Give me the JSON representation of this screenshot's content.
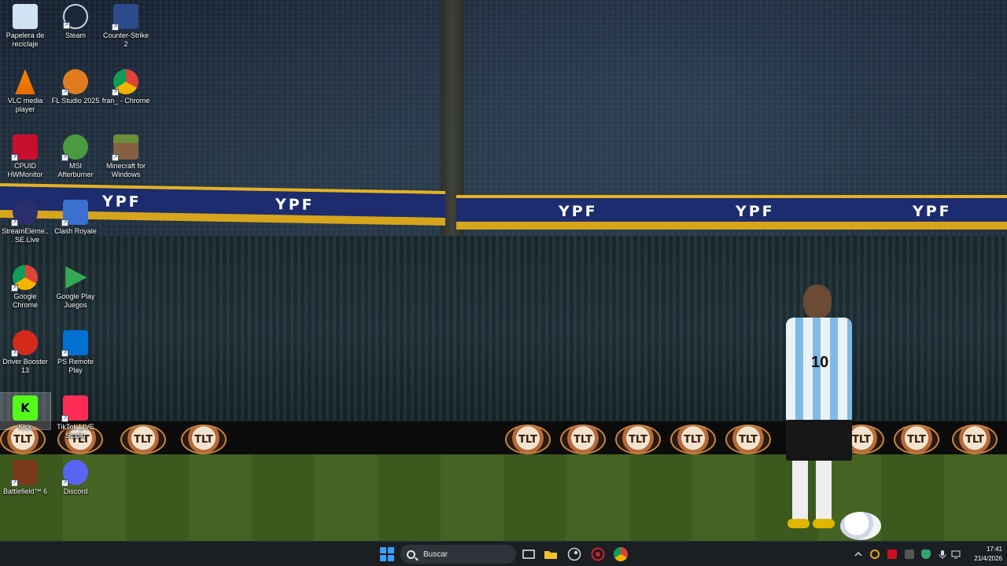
{
  "desktop": {
    "icons": [
      {
        "label": "Papelera de reciclaje",
        "icon": "recycle-bin-icon",
        "color": "#cfe3f5"
      },
      {
        "label": "Steam",
        "icon": "steam-icon",
        "color": "#1b2838"
      },
      {
        "label": "Counter-Strike 2",
        "icon": "counter-strike-icon",
        "color": "#2d4a8a"
      },
      {
        "label": "VLC media player",
        "icon": "vlc-icon",
        "color": "#f08a00"
      },
      {
        "label": "FL Studio 2025",
        "icon": "fl-studio-icon",
        "color": "#e07c1f"
      },
      {
        "label": "fran_ - Chrome",
        "icon": "chrome-profile-icon",
        "color": "#4285f4"
      },
      {
        "label": "CPUID HWMonitor",
        "icon": "hwmonitor-icon",
        "color": "#c8102e"
      },
      {
        "label": "MSI Afterburner",
        "icon": "msi-afterburner-icon",
        "color": "#4a9b3f"
      },
      {
        "label": "Minecraft for Windows",
        "icon": "minecraft-icon",
        "color": "#6b8e3a"
      },
      {
        "label": "StreamEleme... SE.Live",
        "icon": "streamelements-icon",
        "color": "#2a2e6b"
      },
      {
        "label": "Clash Royale",
        "icon": "clash-royale-icon",
        "color": "#3b6fd0"
      },
      {
        "label": "Google Chrome",
        "icon": "chrome-icon",
        "color": "#db4437"
      },
      {
        "label": "Google Play Juegos",
        "icon": "google-play-games-icon",
        "color": "#34a853"
      },
      {
        "label": "Driver Booster 13",
        "icon": "driver-booster-icon",
        "color": "#d42a1c"
      },
      {
        "label": "PS Remote Play",
        "icon": "ps-remote-play-icon",
        "color": "#0070d1"
      },
      {
        "label": "Kick",
        "icon": "kick-icon",
        "color": "#53fc18"
      },
      {
        "label": "TikTok LIVE Studio",
        "icon": "tiktok-live-studio-icon",
        "color": "#fe2c55"
      },
      {
        "label": "Battlefield™ 6",
        "icon": "battlefield-icon",
        "color": "#7a3a1a"
      },
      {
        "label": "Discord",
        "icon": "discord-icon",
        "color": "#5865f2"
      }
    ]
  },
  "wallpaper": {
    "banner_text": "YPF",
    "hoarding_text": "TLT",
    "jersey_number": "10"
  },
  "taskbar": {
    "search_placeholder": "Buscar",
    "apps": [
      {
        "name": "task-view-icon",
        "color": "#e8e8e8"
      },
      {
        "name": "file-explorer-icon",
        "color": "#f2c230"
      },
      {
        "name": "steam-taskbar-icon",
        "color": "#cfcfcf"
      },
      {
        "name": "recording-app-icon",
        "color": "#d0202a"
      },
      {
        "name": "chrome-taskbar-icon",
        "color": "#4285f4"
      }
    ],
    "tray": [
      {
        "name": "show-hidden-icons-chevron",
        "color": "#dcdcdc"
      },
      {
        "name": "sync-tray-icon",
        "color": "#f0a020"
      },
      {
        "name": "app-tray-icon-red",
        "color": "#d01020"
      },
      {
        "name": "app-tray-icon-dark",
        "color": "#555555"
      },
      {
        "name": "security-tray-icon",
        "color": "#2fa46b"
      },
      {
        "name": "microphone-tray-icon",
        "color": "#dcdcdc"
      },
      {
        "name": "network-tray-icon",
        "color": "#dcdcdc"
      },
      {
        "name": "volume-tray-icon",
        "color": "#dcdcdc"
      }
    ],
    "time": "17:41",
    "date": "21/4/2026"
  }
}
